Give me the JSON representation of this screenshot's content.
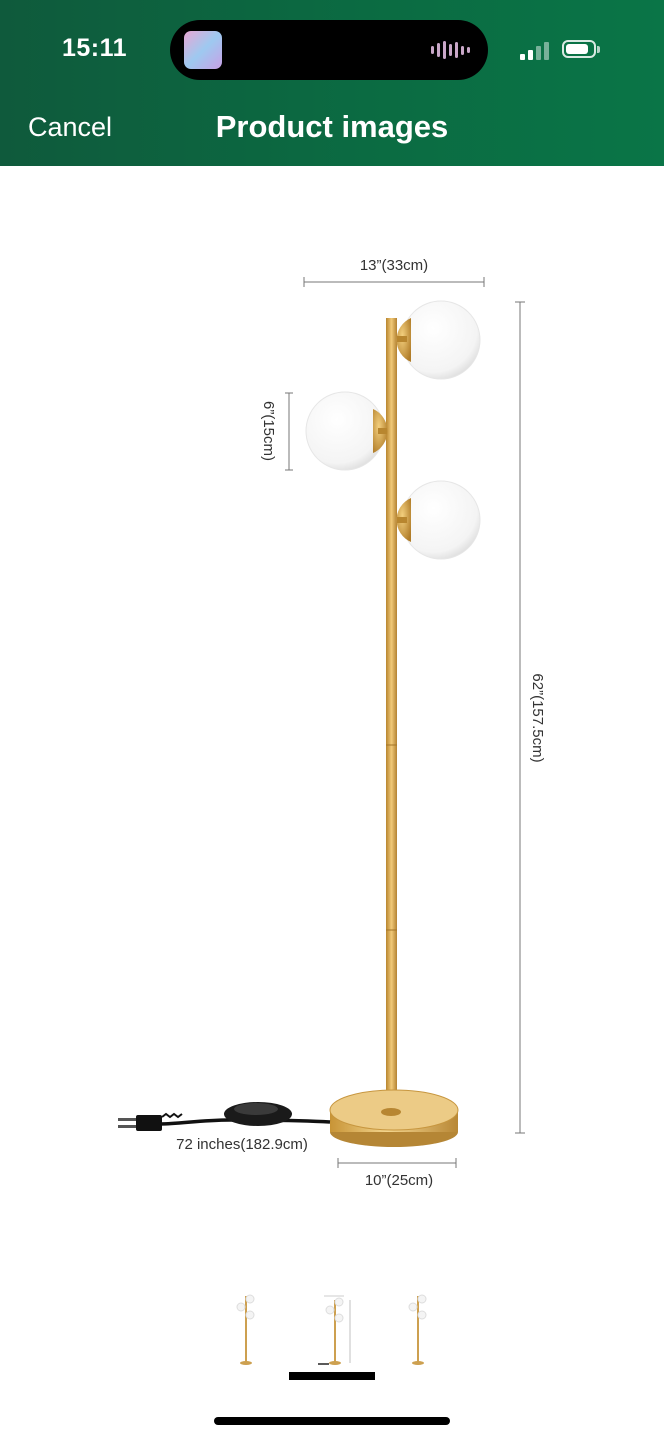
{
  "status_bar": {
    "time": "15:11"
  },
  "nav": {
    "cancel_label": "Cancel",
    "title": "Product images"
  },
  "dimensions": {
    "width_label": "13”(33cm)",
    "globe_label": "6”(15cm)",
    "height_label": "62”(157.5cm)",
    "cord_label": "72 inches(182.9cm)",
    "base_label": "10”(25cm)"
  },
  "gallery": {
    "thumbnail_count": 3,
    "selected_index": 1
  },
  "colors": {
    "header_green": "#0b6b42",
    "brass": "#d4a24a",
    "globe": "#ffffff"
  }
}
